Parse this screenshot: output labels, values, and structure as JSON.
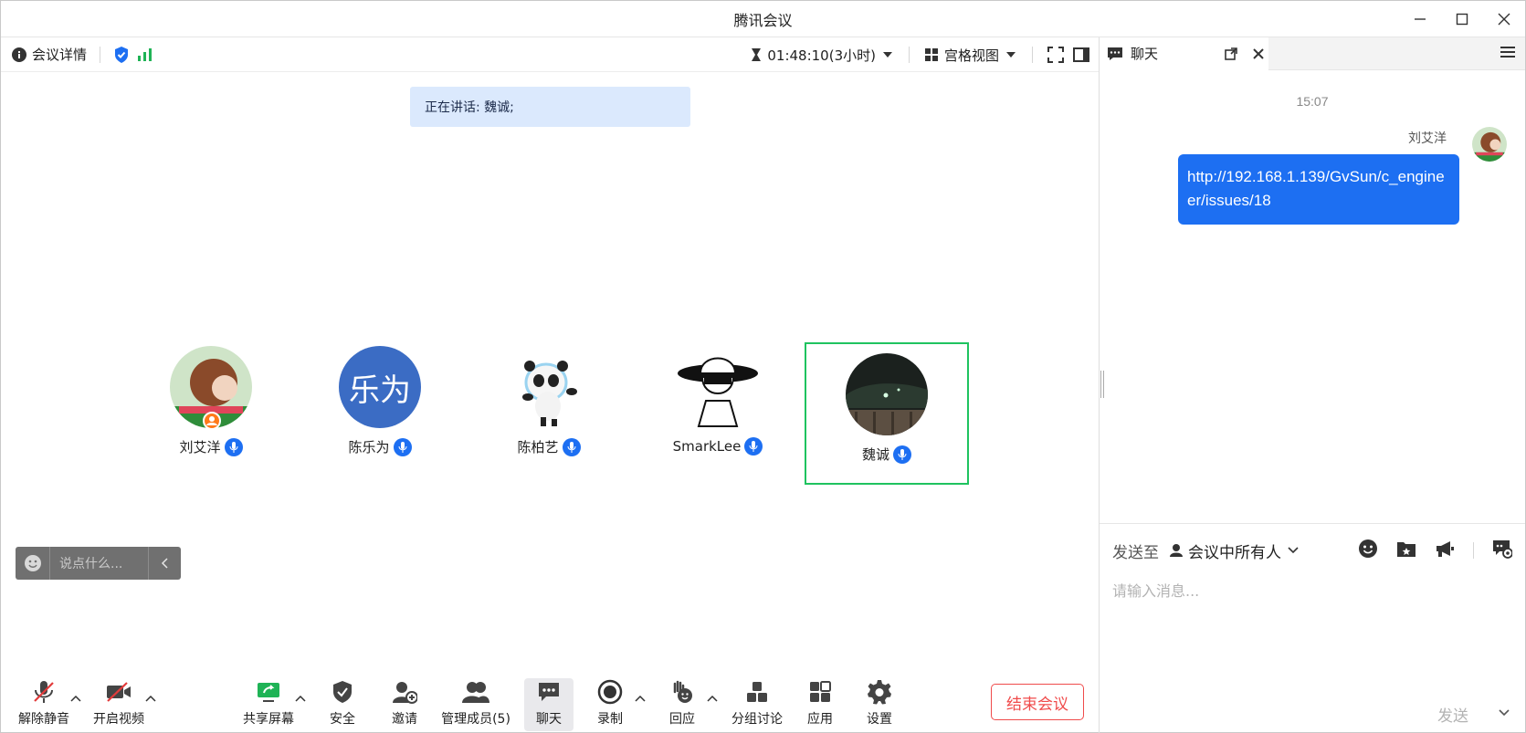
{
  "window": {
    "title": "腾讯会议"
  },
  "top_bar": {
    "meeting_info_label": "会议详情",
    "timer": "01:48:10(3小时)",
    "view_label": "宫格视图"
  },
  "stage": {
    "speaking_text": "正在讲话: 魏诚;",
    "participants": [
      {
        "name": "刘艾洋"
      },
      {
        "name": "陈乐为",
        "avatar_text": "乐为"
      },
      {
        "name": "陈柏艺"
      },
      {
        "name": "SmarkLee"
      },
      {
        "name": "魏诚"
      }
    ],
    "say_placeholder": "说点什么..."
  },
  "toolbar": {
    "unmute": "解除静音",
    "start_video": "开启视频",
    "share_screen": "共享屏幕",
    "security": "安全",
    "invite": "邀请",
    "manage_members": "管理成员(5)",
    "chat": "聊天",
    "record": "录制",
    "react": "回应",
    "breakout": "分组讨论",
    "apps": "应用",
    "settings": "设置",
    "end_meeting": "结束会议"
  },
  "chat": {
    "tab_label": "聊天",
    "time": "15:07",
    "sender": "刘艾洋",
    "message": "http://192.168.1.139/GvSun/c_engineer/issues/18",
    "send_to_label": "发送至",
    "send_target": "会议中所有人",
    "input_placeholder": "请输入消息...",
    "send_button": "发送"
  },
  "colors": {
    "accent_blue": "#1d6ff2",
    "active_border": "#1fc35f",
    "end_red": "#f04b4b",
    "speaking_bg": "#dbe9fd"
  }
}
